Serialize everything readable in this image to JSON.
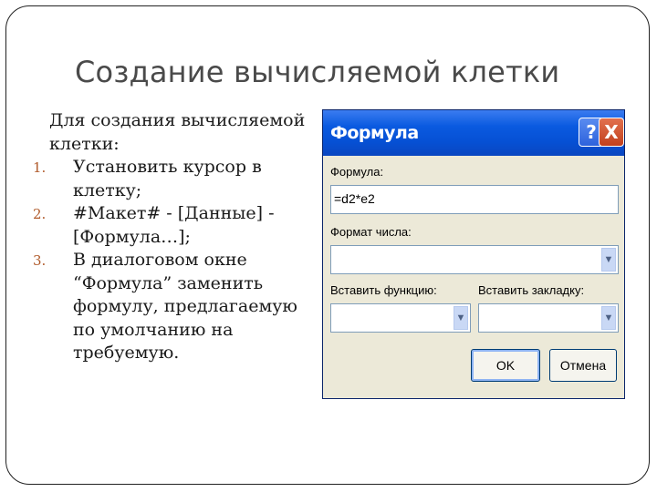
{
  "slide": {
    "title": "Создание  вычисляемой клетки",
    "intro": "Для создания вычисляемой клетки:",
    "steps": [
      {
        "num": "1.",
        "text": "Установить курсор в клетку;"
      },
      {
        "num": "2.",
        "text": "#Макет# - [Данные] - [Формула…];"
      },
      {
        "num": "3.",
        "text": "В  диалоговом окне “Формула” заменить формулу, предлагаемую по умолчанию на требуемую."
      }
    ]
  },
  "dialog": {
    "title": "Формула",
    "help_icon": "?",
    "close_icon": "X",
    "formula_label": "Формула:",
    "formula_value": "=d2*e2",
    "number_format_label": "Формат числа:",
    "number_format_value": "",
    "insert_function_label": "Вставить функцию:",
    "insert_function_value": "",
    "insert_bookmark_label": "Вставить закладку:",
    "insert_bookmark_value": "",
    "ok_label": "OK",
    "cancel_label": "Отмена"
  }
}
